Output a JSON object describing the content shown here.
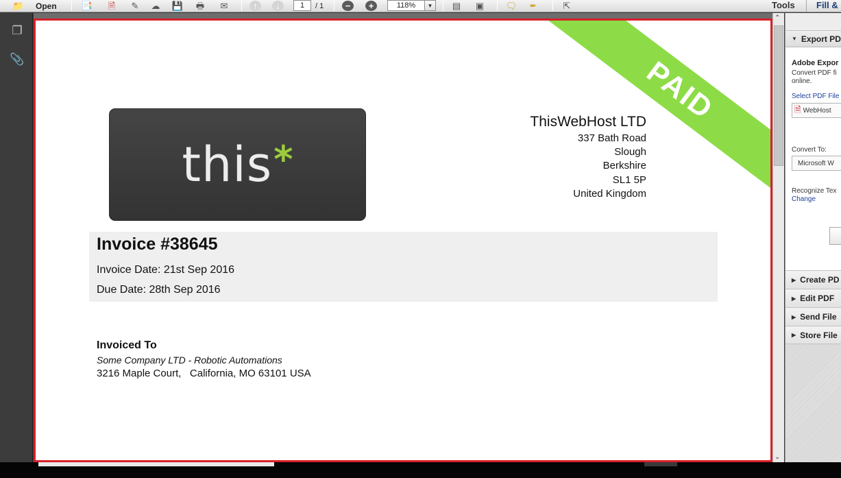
{
  "toolbar": {
    "open_label": "Open",
    "page_current": "1",
    "page_total": "/ 1",
    "zoom": "118%",
    "tools_label": "Tools",
    "fill_label": "Fill &"
  },
  "document": {
    "paid_label": "PAID",
    "logo_text": "this",
    "logo_star": "*",
    "company_name": "ThisWebHost LTD",
    "company_address": [
      "337 Bath Road",
      "Slough",
      "Berkshire",
      "SL1 5P",
      "United Kingdom"
    ],
    "invoice_number": "Invoice #38645",
    "invoice_date": "Invoice Date: 21st Sep 2016",
    "due_date": "Due Date: 28th Sep 2016",
    "invoiced_to_heading": "Invoiced To",
    "invoiced_to_company": "Some Company LTD - Robotic Automations",
    "invoiced_to_address": "3216 Maple Court,   California, MO 63101 USA"
  },
  "right_panel": {
    "export_header": "Export PD",
    "adobe_title": "Adobe Expor",
    "convert_desc_line1": "Convert PDF fi",
    "convert_desc_line2": "online.",
    "select_link": "Select PDF File",
    "selected_file": "WebHost",
    "convert_to_label": "Convert To:",
    "format_value": "Microsoft W",
    "recognize_label": "Recognize Tex",
    "change_link": "Change",
    "sections": [
      "Create PD",
      "Edit PDF",
      "Send File",
      "Store File"
    ]
  },
  "colors": {
    "paid_ribbon": "#8ddc47",
    "page_border": "#d9202a",
    "logo_star": "#9ccc3c",
    "link": "#1a3d9a"
  }
}
